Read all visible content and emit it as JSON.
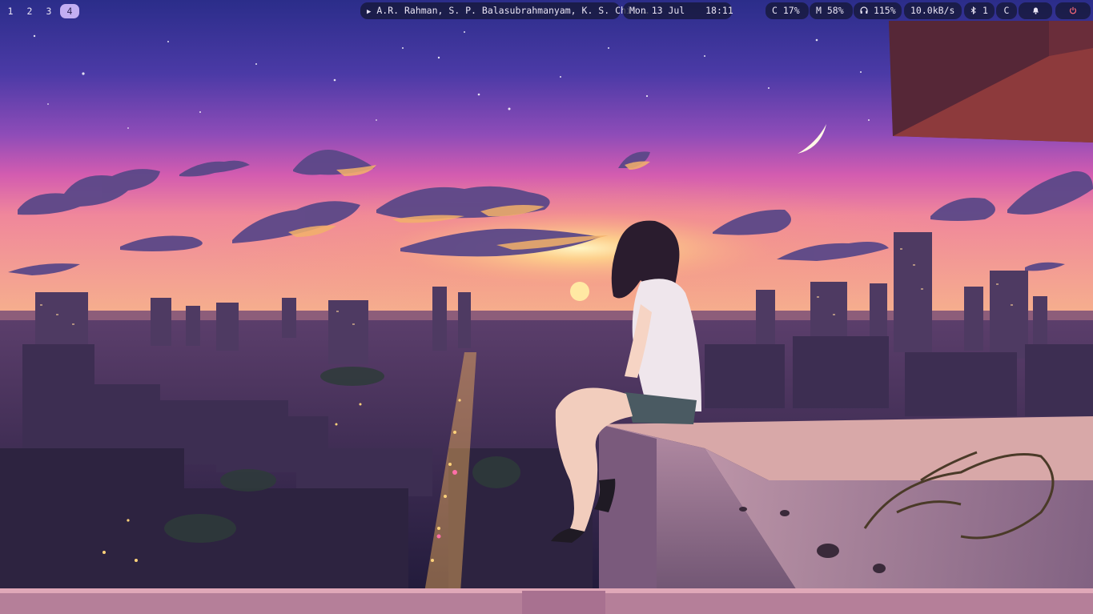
{
  "workspaces": {
    "items": [
      "1",
      "2",
      "3",
      "4"
    ],
    "active": "4"
  },
  "media": {
    "play_icon": "▶",
    "now_playing": "A.R. Rahman, S. P. Balasubrahmanyam, K. S. Chit …"
  },
  "clock": {
    "date": "Mon 13 Jul",
    "time": "18:11"
  },
  "status": {
    "cpu_label": "C",
    "cpu_value": "17%",
    "mem_label": "M",
    "mem_value": "58%",
    "headphone_icon": "headphones-icon",
    "volume_value": "115%",
    "network_value": "10.0kB/s",
    "bluetooth_icon": "bluetooth-icon",
    "bluetooth_count": "1",
    "extra_label": "C",
    "bell_icon": "bell-icon",
    "power_icon": "power-icon"
  },
  "colors": {
    "accent": "#c3aef2",
    "pill_bg": "#141630",
    "text": "#e9e4f4",
    "power": "#ff6b7a"
  }
}
